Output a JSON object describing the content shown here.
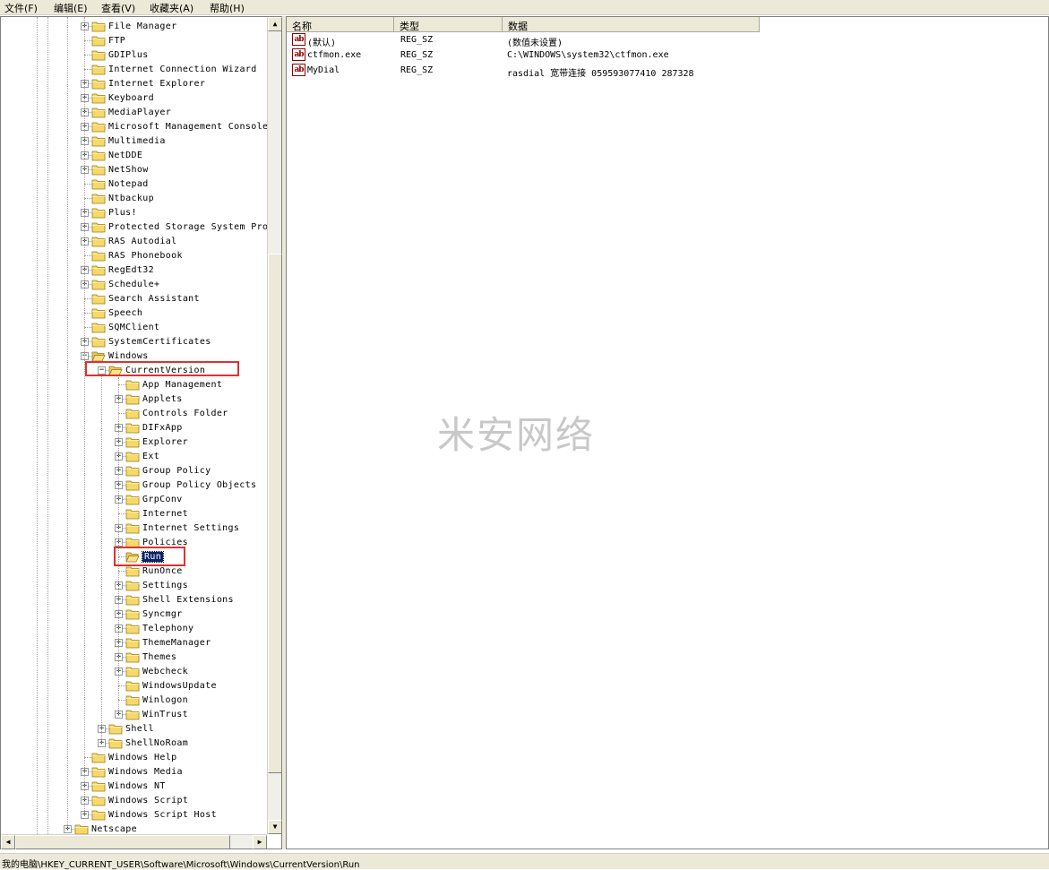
{
  "menu": [
    {
      "label": "文件(F)"
    },
    {
      "label": "编辑(E)"
    },
    {
      "label": "查看(V)"
    },
    {
      "label": "收藏夹(A)"
    },
    {
      "label": "帮助(H)"
    }
  ],
  "tree": [
    {
      "label": "File Manager",
      "expander": "+"
    },
    {
      "label": "FTP",
      "expander": ""
    },
    {
      "label": "GDIPlus",
      "expander": ""
    },
    {
      "label": "Internet Connection Wizard",
      "expander": ""
    },
    {
      "label": "Internet Explorer",
      "expander": "+"
    },
    {
      "label": "Keyboard",
      "expander": "+"
    },
    {
      "label": "MediaPlayer",
      "expander": "+"
    },
    {
      "label": "Microsoft Management Console",
      "expander": "+"
    },
    {
      "label": "Multimedia",
      "expander": "+"
    },
    {
      "label": "NetDDE",
      "expander": "+"
    },
    {
      "label": "NetShow",
      "expander": "+"
    },
    {
      "label": "Notepad",
      "expander": ""
    },
    {
      "label": "Ntbackup",
      "expander": ""
    },
    {
      "label": "Plus!",
      "expander": "+"
    },
    {
      "label": "Protected Storage System Prov:",
      "expander": "+"
    },
    {
      "label": "RAS Autodial",
      "expander": "+"
    },
    {
      "label": "RAS Phonebook",
      "expander": ""
    },
    {
      "label": "RegEdt32",
      "expander": "+"
    },
    {
      "label": "Schedule+",
      "expander": "+"
    },
    {
      "label": "Search Assistant",
      "expander": ""
    },
    {
      "label": "Speech",
      "expander": ""
    },
    {
      "label": "SQMClient",
      "expander": ""
    },
    {
      "label": "SystemCertificates",
      "expander": "+"
    },
    {
      "label": "Windows",
      "expander": "-"
    },
    {
      "label": "CurrentVersion",
      "expander": "-"
    },
    {
      "label": "App Management",
      "expander": ""
    },
    {
      "label": "Applets",
      "expander": "+"
    },
    {
      "label": "Controls Folder",
      "expander": ""
    },
    {
      "label": "DIFxApp",
      "expander": "+"
    },
    {
      "label": "Explorer",
      "expander": "+"
    },
    {
      "label": "Ext",
      "expander": "+"
    },
    {
      "label": "Group Policy",
      "expander": "+"
    },
    {
      "label": "Group Policy Objects",
      "expander": "+"
    },
    {
      "label": "GrpConv",
      "expander": "+"
    },
    {
      "label": "Internet",
      "expander": ""
    },
    {
      "label": "Internet Settings",
      "expander": "+"
    },
    {
      "label": "Policies",
      "expander": "+"
    },
    {
      "label": "Run",
      "expander": "",
      "selected": true
    },
    {
      "label": "RunOnce",
      "expander": ""
    },
    {
      "label": "Settings",
      "expander": "+"
    },
    {
      "label": "Shell Extensions",
      "expander": "+"
    },
    {
      "label": "Syncmgr",
      "expander": "+"
    },
    {
      "label": "Telephony",
      "expander": "+"
    },
    {
      "label": "ThemeManager",
      "expander": "+"
    },
    {
      "label": "Themes",
      "expander": "+"
    },
    {
      "label": "Webcheck",
      "expander": "+"
    },
    {
      "label": "WindowsUpdate",
      "expander": ""
    },
    {
      "label": "Winlogon",
      "expander": ""
    },
    {
      "label": "WinTrust",
      "expander": "+"
    },
    {
      "label": "Shell",
      "expander": "+"
    },
    {
      "label": "ShellNoRoam",
      "expander": "+"
    },
    {
      "label": "Windows Help",
      "expander": ""
    },
    {
      "label": "Windows Media",
      "expander": "+"
    },
    {
      "label": "Windows NT",
      "expander": "+"
    },
    {
      "label": "Windows Script",
      "expander": "+"
    },
    {
      "label": "Windows Script Host",
      "expander": "+"
    },
    {
      "label": "Netscape",
      "expander": "+"
    }
  ],
  "list": {
    "columns": [
      "名称",
      "类型",
      "数据"
    ],
    "rows": [
      {
        "icon": "string-value-icon",
        "name": "(默认)",
        "type": "REG_SZ",
        "data": "(数值未设置)"
      },
      {
        "icon": "string-value-icon",
        "name": "ctfmon.exe",
        "type": "REG_SZ",
        "data": "C:\\WINDOWS\\system32\\ctfmon.exe"
      },
      {
        "icon": "string-value-icon",
        "name": "MyDial",
        "type": "REG_SZ",
        "data": "rasdial 宽带连接 059593077410 287328"
      }
    ]
  },
  "watermark": "米安网络",
  "status": {
    "path": "我的电脑\\HKEY_CURRENT_USER\\Software\\Microsoft\\Windows\\CurrentVersion\\Run"
  },
  "colors": {
    "highlight_box": "#e03030",
    "selection": "#0a246a"
  }
}
